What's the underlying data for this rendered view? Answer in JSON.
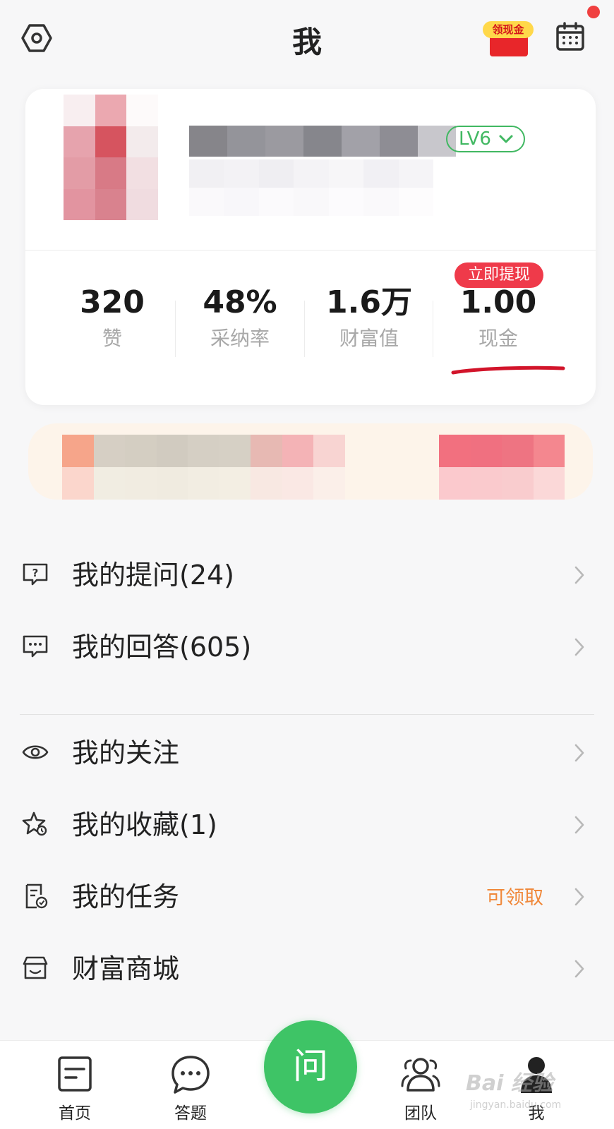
{
  "header": {
    "title": "我",
    "redpacket_label": "领现金"
  },
  "profile": {
    "level": "LV6",
    "stats": [
      {
        "value": "320",
        "label": "赞"
      },
      {
        "value": "48%",
        "label": "采纳率"
      },
      {
        "value": "1.6万",
        "label": "财富值"
      },
      {
        "value": "1.00",
        "label": "现金"
      }
    ],
    "withdraw_tag": "立即提现"
  },
  "menu": [
    {
      "label": "我的提问(24)",
      "icon": "question-icon"
    },
    {
      "label": "我的回答(605)",
      "icon": "chat-icon"
    },
    {
      "label": "我的关注",
      "icon": "eye-icon"
    },
    {
      "label": "我的收藏(1)",
      "icon": "star-icon"
    },
    {
      "label": "我的任务",
      "icon": "task-icon",
      "extra": "可领取"
    },
    {
      "label": "财富商城",
      "icon": "shop-icon"
    }
  ],
  "tabbar": {
    "tabs": [
      {
        "label": "首页",
        "icon": "home-icon"
      },
      {
        "label": "答题",
        "icon": "answer-icon"
      },
      {
        "label": "团队",
        "icon": "team-icon"
      },
      {
        "label": "我",
        "icon": "profile-icon"
      }
    ],
    "ask_label": "问"
  },
  "watermark": {
    "brand": "Bai 经验",
    "url": "jingyan.baidu.com"
  },
  "colors": {
    "accent_green": "#3ec466",
    "level_green": "#41b862",
    "withdraw_red": "#ef3a4a",
    "task_orange": "#f0883a",
    "marker_red": "#d2142a"
  }
}
